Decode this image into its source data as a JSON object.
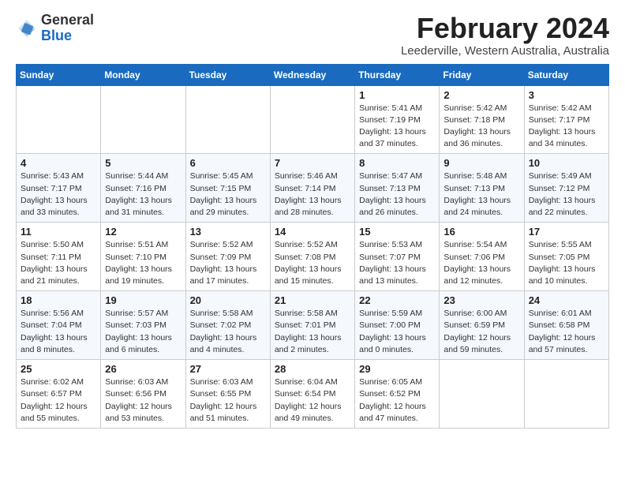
{
  "header": {
    "logo_general": "General",
    "logo_blue": "Blue",
    "month_title": "February 2024",
    "location": "Leederville, Western Australia, Australia"
  },
  "calendar": {
    "days_of_week": [
      "Sunday",
      "Monday",
      "Tuesday",
      "Wednesday",
      "Thursday",
      "Friday",
      "Saturday"
    ],
    "weeks": [
      [
        {
          "day": "",
          "info": ""
        },
        {
          "day": "",
          "info": ""
        },
        {
          "day": "",
          "info": ""
        },
        {
          "day": "",
          "info": ""
        },
        {
          "day": "1",
          "info": "Sunrise: 5:41 AM\nSunset: 7:19 PM\nDaylight: 13 hours\nand 37 minutes."
        },
        {
          "day": "2",
          "info": "Sunrise: 5:42 AM\nSunset: 7:18 PM\nDaylight: 13 hours\nand 36 minutes."
        },
        {
          "day": "3",
          "info": "Sunrise: 5:42 AM\nSunset: 7:17 PM\nDaylight: 13 hours\nand 34 minutes."
        }
      ],
      [
        {
          "day": "4",
          "info": "Sunrise: 5:43 AM\nSunset: 7:17 PM\nDaylight: 13 hours\nand 33 minutes."
        },
        {
          "day": "5",
          "info": "Sunrise: 5:44 AM\nSunset: 7:16 PM\nDaylight: 13 hours\nand 31 minutes."
        },
        {
          "day": "6",
          "info": "Sunrise: 5:45 AM\nSunset: 7:15 PM\nDaylight: 13 hours\nand 29 minutes."
        },
        {
          "day": "7",
          "info": "Sunrise: 5:46 AM\nSunset: 7:14 PM\nDaylight: 13 hours\nand 28 minutes."
        },
        {
          "day": "8",
          "info": "Sunrise: 5:47 AM\nSunset: 7:13 PM\nDaylight: 13 hours\nand 26 minutes."
        },
        {
          "day": "9",
          "info": "Sunrise: 5:48 AM\nSunset: 7:13 PM\nDaylight: 13 hours\nand 24 minutes."
        },
        {
          "day": "10",
          "info": "Sunrise: 5:49 AM\nSunset: 7:12 PM\nDaylight: 13 hours\nand 22 minutes."
        }
      ],
      [
        {
          "day": "11",
          "info": "Sunrise: 5:50 AM\nSunset: 7:11 PM\nDaylight: 13 hours\nand 21 minutes."
        },
        {
          "day": "12",
          "info": "Sunrise: 5:51 AM\nSunset: 7:10 PM\nDaylight: 13 hours\nand 19 minutes."
        },
        {
          "day": "13",
          "info": "Sunrise: 5:52 AM\nSunset: 7:09 PM\nDaylight: 13 hours\nand 17 minutes."
        },
        {
          "day": "14",
          "info": "Sunrise: 5:52 AM\nSunset: 7:08 PM\nDaylight: 13 hours\nand 15 minutes."
        },
        {
          "day": "15",
          "info": "Sunrise: 5:53 AM\nSunset: 7:07 PM\nDaylight: 13 hours\nand 13 minutes."
        },
        {
          "day": "16",
          "info": "Sunrise: 5:54 AM\nSunset: 7:06 PM\nDaylight: 13 hours\nand 12 minutes."
        },
        {
          "day": "17",
          "info": "Sunrise: 5:55 AM\nSunset: 7:05 PM\nDaylight: 13 hours\nand 10 minutes."
        }
      ],
      [
        {
          "day": "18",
          "info": "Sunrise: 5:56 AM\nSunset: 7:04 PM\nDaylight: 13 hours\nand 8 minutes."
        },
        {
          "day": "19",
          "info": "Sunrise: 5:57 AM\nSunset: 7:03 PM\nDaylight: 13 hours\nand 6 minutes."
        },
        {
          "day": "20",
          "info": "Sunrise: 5:58 AM\nSunset: 7:02 PM\nDaylight: 13 hours\nand 4 minutes."
        },
        {
          "day": "21",
          "info": "Sunrise: 5:58 AM\nSunset: 7:01 PM\nDaylight: 13 hours\nand 2 minutes."
        },
        {
          "day": "22",
          "info": "Sunrise: 5:59 AM\nSunset: 7:00 PM\nDaylight: 13 hours\nand 0 minutes."
        },
        {
          "day": "23",
          "info": "Sunrise: 6:00 AM\nSunset: 6:59 PM\nDaylight: 12 hours\nand 59 minutes."
        },
        {
          "day": "24",
          "info": "Sunrise: 6:01 AM\nSunset: 6:58 PM\nDaylight: 12 hours\nand 57 minutes."
        }
      ],
      [
        {
          "day": "25",
          "info": "Sunrise: 6:02 AM\nSunset: 6:57 PM\nDaylight: 12 hours\nand 55 minutes."
        },
        {
          "day": "26",
          "info": "Sunrise: 6:03 AM\nSunset: 6:56 PM\nDaylight: 12 hours\nand 53 minutes."
        },
        {
          "day": "27",
          "info": "Sunrise: 6:03 AM\nSunset: 6:55 PM\nDaylight: 12 hours\nand 51 minutes."
        },
        {
          "day": "28",
          "info": "Sunrise: 6:04 AM\nSunset: 6:54 PM\nDaylight: 12 hours\nand 49 minutes."
        },
        {
          "day": "29",
          "info": "Sunrise: 6:05 AM\nSunset: 6:52 PM\nDaylight: 12 hours\nand 47 minutes."
        },
        {
          "day": "",
          "info": ""
        },
        {
          "day": "",
          "info": ""
        }
      ]
    ]
  }
}
